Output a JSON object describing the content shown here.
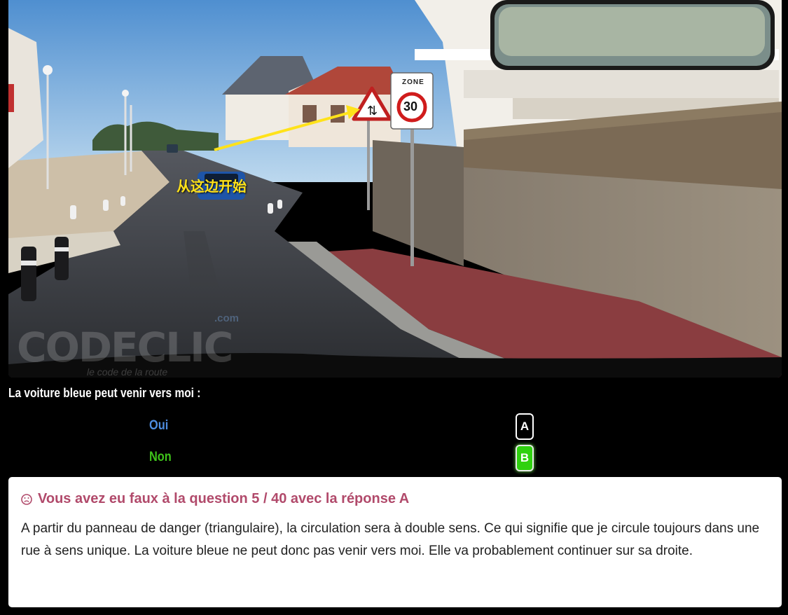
{
  "photo": {
    "annotation_label": "从这边开始",
    "sign_zone_text": "ZONE",
    "sign_speed_text": "30",
    "watermark_brand": "CODECLIC",
    "watermark_domain": ".com",
    "watermark_tagline": "le code de la route"
  },
  "quiz": {
    "question": "La voiture bleue peut venir vers moi :",
    "answers": [
      {
        "text": "Oui",
        "key": "A",
        "selected": false,
        "color": "#4e8de0"
      },
      {
        "text": "Non",
        "key": "B",
        "selected": true,
        "color": "#3ec21a"
      }
    ]
  },
  "feedback": {
    "icon": "sad-face-icon",
    "title": "Vous avez eu faux à la question 5 / 40 avec la réponse A",
    "explanation": "A partir du panneau de danger (triangulaire), la circulation sera à double sens. Ce qui signifie que je circule toujours dans une rue à sens unique. La voiture bleue ne peut donc pas venir vers moi. Elle va probablement continuer sur sa droite.",
    "title_color": "#b14a6b"
  }
}
